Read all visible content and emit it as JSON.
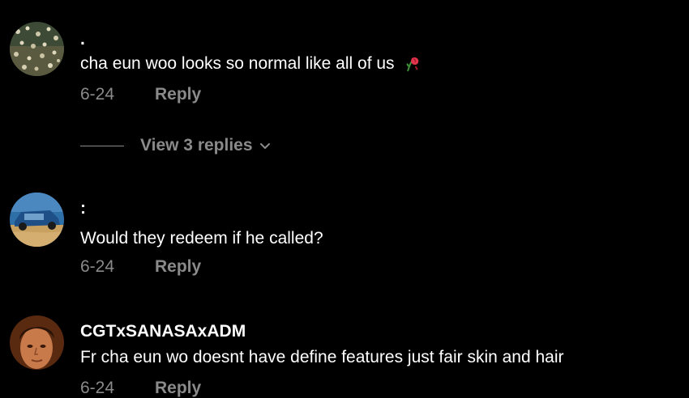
{
  "comments": [
    {
      "username": ".",
      "text": "cha eun woo looks so normal like all of us",
      "emoji_icon": "wilted-rose-icon",
      "date": "6-24",
      "reply_label": "Reply",
      "avatar_icon": "flower-field-avatar"
    },
    {
      "username": ":",
      "text": "Would they redeem if he called?",
      "date": "6-24",
      "reply_label": "Reply",
      "avatar_icon": "car-avatar"
    },
    {
      "username": "CGTxSANASAxADM",
      "text": "Fr cha eun wo doesnt have define features just fair skin and hair",
      "date": "6-24",
      "reply_label": "Reply",
      "avatar_icon": "face-avatar"
    }
  ],
  "view_replies": {
    "label": "View 3 replies",
    "icon": "chevron-down-icon"
  },
  "colors": {
    "background": "#000000",
    "text": "#ffffff",
    "muted": "#8a8a8a",
    "rose": "#e0344a"
  }
}
